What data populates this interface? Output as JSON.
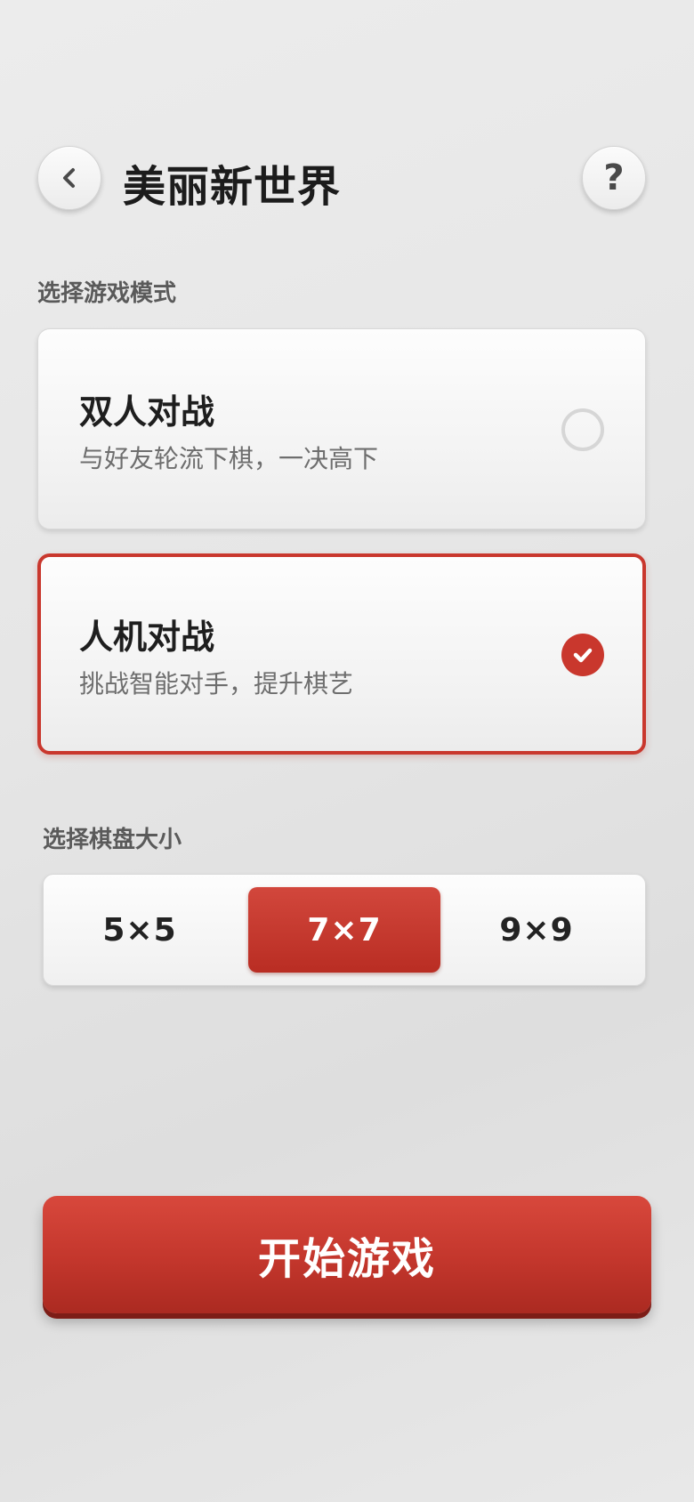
{
  "header": {
    "title": "美丽新世界",
    "back_icon": "chevron-left-icon",
    "help_label": "?"
  },
  "mode_section": {
    "label": "选择游戏模式",
    "options": [
      {
        "title": "双人对战",
        "desc": "与好友轮流下棋，一决高下",
        "selected": false
      },
      {
        "title": "人机对战",
        "desc": "挑战智能对手，提升棋艺",
        "selected": true
      }
    ]
  },
  "size_section": {
    "label": "选择棋盘大小",
    "options": [
      "5×5",
      "7×7",
      "9×9"
    ],
    "selected": "7×7"
  },
  "start_button": {
    "label": "开始游戏"
  },
  "colors": {
    "accent": "#c9372d",
    "background": "#e6e6e6",
    "text": "#1e1e1e",
    "muted": "#6e6e6e"
  }
}
